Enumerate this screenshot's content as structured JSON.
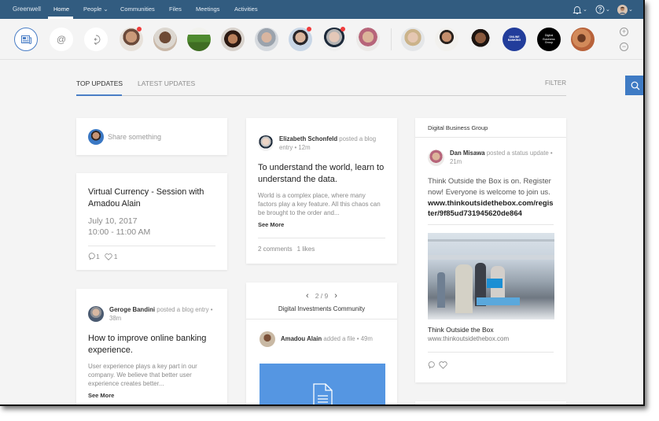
{
  "nav": {
    "brand": "Greenwell",
    "items": [
      {
        "label": "Home",
        "active": true
      },
      {
        "label": "People ⌄"
      },
      {
        "label": "Communities"
      },
      {
        "label": "Files"
      },
      {
        "label": "Meetings"
      },
      {
        "label": "Activities"
      }
    ],
    "icons": [
      "bell-icon",
      "help-icon",
      "user-avatar"
    ],
    "dropdown_glyph": "⌄"
  },
  "strip": {
    "at_symbol": "@",
    "people": [
      {
        "name": "person-1",
        "notification": true
      },
      {
        "name": "person-2"
      },
      {
        "name": "tree-community"
      },
      {
        "name": "person-3"
      },
      {
        "name": "person-4"
      },
      {
        "name": "person-5",
        "notification": true
      },
      {
        "name": "person-6",
        "notification": true
      },
      {
        "name": "person-7"
      },
      {
        "name": "person-8"
      },
      {
        "name": "person-9"
      },
      {
        "name": "person-10"
      },
      {
        "name": "online-banking",
        "label": "ONLINE BANKING"
      },
      {
        "name": "digital-business-group",
        "label": "Digital Business Group"
      },
      {
        "name": "shoes-community"
      }
    ],
    "zoom_in": "+",
    "zoom_out": "−"
  },
  "tabs": {
    "top": "TOP UPDATES",
    "latest": "LATEST UPDATES",
    "filter": "FILTER"
  },
  "share": {
    "placeholder": "Share something"
  },
  "event": {
    "title": "Virtual Currency - Session with Amadou Alain",
    "date": "July 10, 2017",
    "time": "10:00 - 11:00 AM",
    "comments": "1",
    "likes": "1"
  },
  "blog1": {
    "author": "Elizabeth Schonfeld",
    "action": "posted a blog entry",
    "time": "12m",
    "title": "To understand the world, learn to understand the data.",
    "excerpt": "World is a complex place, where many factors play a key feature. All this chaos can be brought to the order and...",
    "see_more": "See More",
    "comments": "2 comments",
    "likes": "1 likes"
  },
  "blog2": {
    "author": "Geroge Bandini",
    "action": "posted a blog entry",
    "time": "38m",
    "title": "How to improve online banking experience.",
    "excerpt": "User experience plays a key part in our company. We believe that better user experience creates better...",
    "see_more": "See More"
  },
  "community": {
    "pager": "2 / 9",
    "prev": "‹",
    "next": "›",
    "name": "Digital Investments Community",
    "author": "Amadou Alain",
    "action": "added a file",
    "time": "49m",
    "file_color": "#5596e2"
  },
  "group": {
    "name": "Digital Business Group",
    "author": "Dan Misawa",
    "action": "posted a status update",
    "time": "21m",
    "text": "Think Outside the Box is on. Register now! Everyone is welcome to join us.",
    "link": "www.thinkoutsidethebox.com/register/9f85ud731945620de864",
    "preview_title": "Think Outside the Box",
    "preview_url": "www.thinkoutsidethebox.com"
  },
  "colors": {
    "nav": "#325c80",
    "accent": "#4a7ec6",
    "notification": "#f03c3c"
  }
}
